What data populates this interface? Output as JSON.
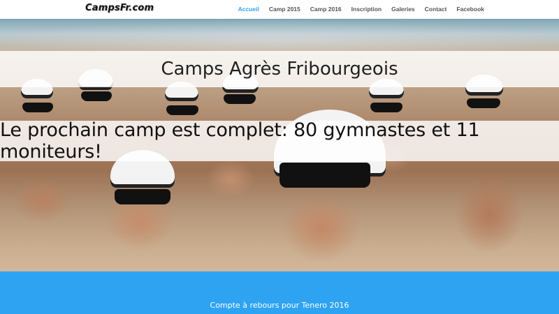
{
  "header": {
    "logo_text": "CampsFr.com",
    "nav": [
      {
        "label": "Accueil",
        "active": true
      },
      {
        "label": "Camp 2015",
        "active": false
      },
      {
        "label": "Camp 2016",
        "active": false
      },
      {
        "label": "Inscription",
        "active": false
      },
      {
        "label": "Galeries",
        "active": false
      },
      {
        "label": "Contact",
        "active": false
      },
      {
        "label": "Facebook",
        "active": false
      }
    ]
  },
  "hero": {
    "title": "Camps Agrès Fribourgeois",
    "announcement": "Le prochain camp est complet: 80 gymnastes et 11 moniteurs!",
    "image_description": "group photo on beach"
  },
  "countdown": {
    "label": "Compte à rebours pour Tenero 2016"
  },
  "colors": {
    "accent": "#2ea3f2",
    "nav_text": "#555555",
    "band_overlay": "rgba(255,255,255,0.82)"
  }
}
